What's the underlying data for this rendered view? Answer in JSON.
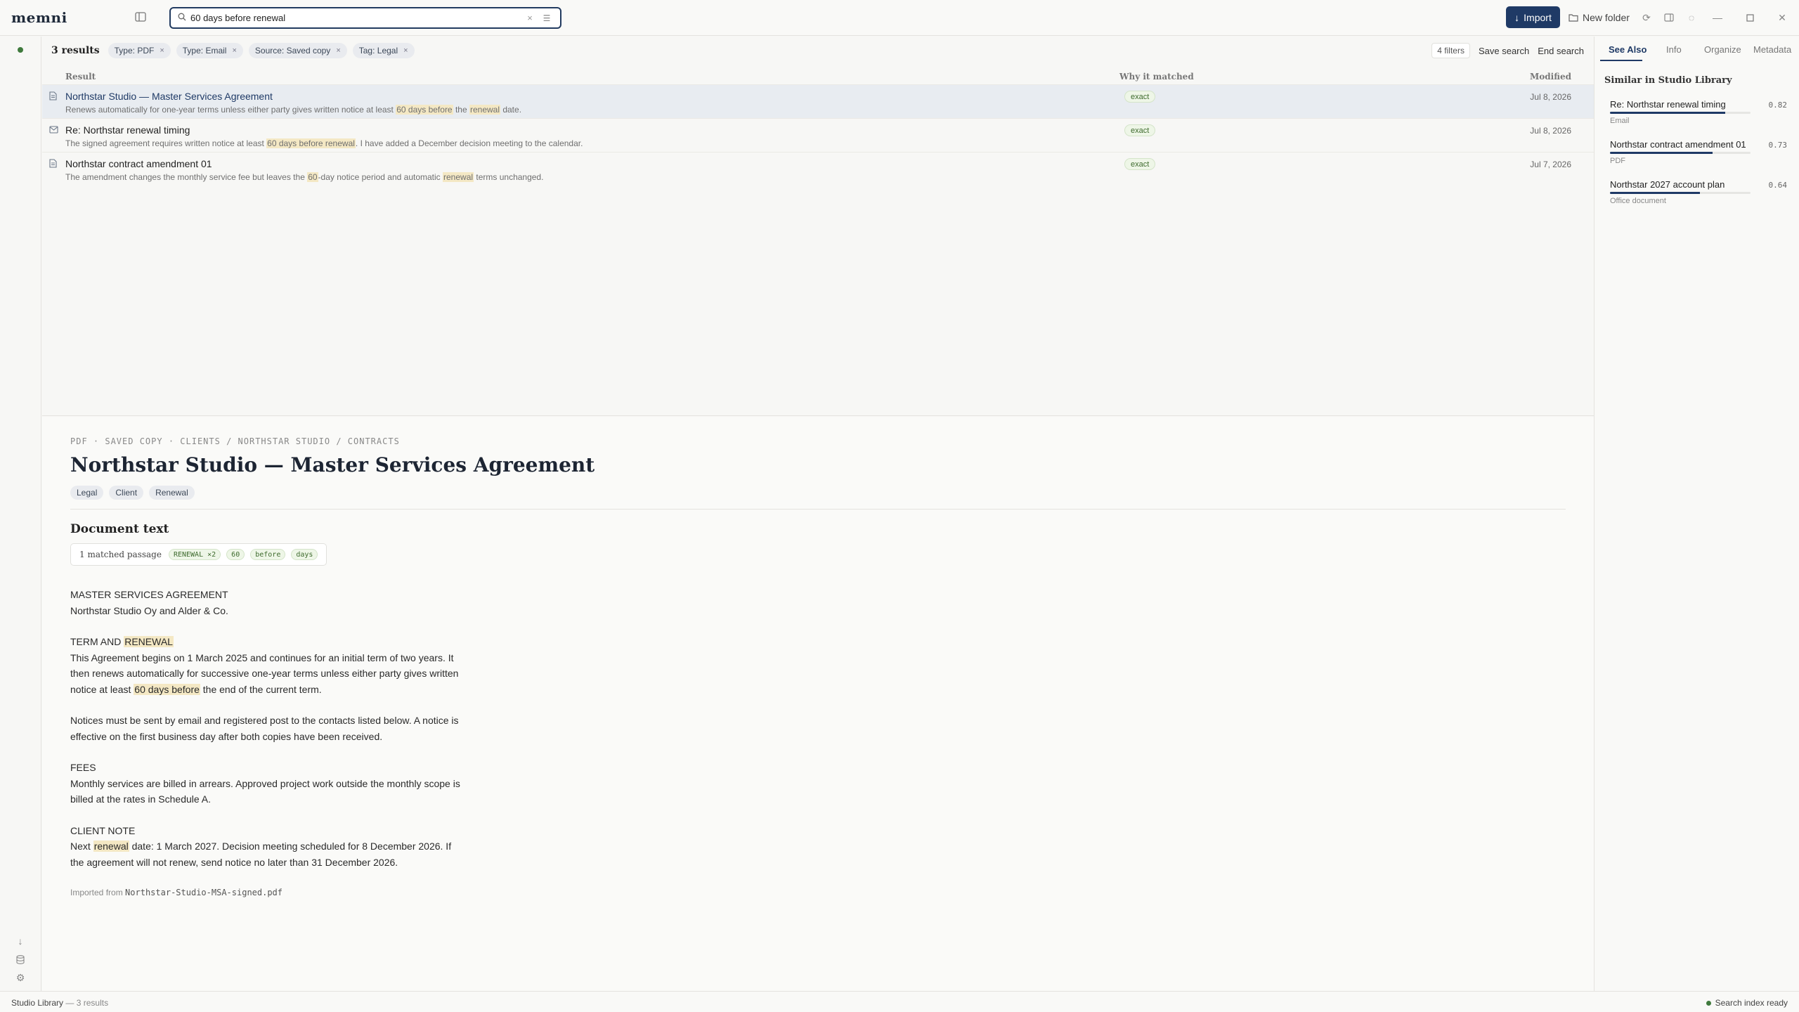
{
  "app": {
    "logo": "memni"
  },
  "search": {
    "value": "60 days before renewal"
  },
  "toolbar": {
    "import_label": "Import",
    "new_folder_label": "New folder"
  },
  "filters": {
    "result_count": "3 results",
    "chips": [
      "Type: PDF",
      "Type: Email",
      "Source: Saved copy",
      "Tag: Legal"
    ],
    "filter_count": "4 filters",
    "save_search": "Save search",
    "end_search": "End search"
  },
  "table": {
    "columns": {
      "result": "Result",
      "why": "Why it matched",
      "modified": "Modified"
    },
    "rows": [
      {
        "icon": "document-icon",
        "title": "Northstar Studio — Master Services Agreement",
        "snippet_html": "Renews automatically for one-year terms unless either party gives written notice at least <mark>60 days before</mark> the <mark>renewal</mark> date.",
        "why": "exact",
        "modified": "Jul 8, 2026"
      },
      {
        "icon": "mail-icon",
        "title": "Re: Northstar renewal timing",
        "snippet_html": "The signed agreement requires written notice at least <mark>60 days before renewal</mark>. I have added a December decision meeting to the calendar.",
        "why": "exact",
        "modified": "Jul 8, 2026"
      },
      {
        "icon": "document-icon",
        "title": "Northstar contract amendment 01",
        "snippet_html": "The amendment changes the monthly service fee but leaves the <mark>60</mark>-day notice period and automatic <mark>renewal</mark> terms unchanged.",
        "why": "exact",
        "modified": "Jul 7, 2026"
      }
    ]
  },
  "preview": {
    "breadcrumb": "PDF · SAVED COPY · CLIENTS / NORTHSTAR STUDIO / CONTRACTS",
    "title": "Northstar Studio — Master Services Agreement",
    "tags": [
      "Legal",
      "Client",
      "Renewal"
    ],
    "section_heading": "Document text",
    "matched_label": "1 matched passage",
    "matched_terms": [
      "RENEWAL ×2",
      "60",
      "before",
      "days"
    ],
    "paragraphs_html": [
      "MASTER SERVICES AGREEMENT<br>Northstar Studio Oy and Alder &amp; Co.",
      "TERM AND <mark>RENEWAL</mark><br>This Agreement begins on 1 March 2025 and continues for an initial term of two years. It then renews automatically for successive one-year terms unless either party gives written notice at least <mark>60 days before</mark> the end of the current term.",
      "Notices must be sent by email and registered post to the contacts listed below. A notice is effective on the first business day after both copies have been received.",
      "FEES<br>Monthly services are billed in arrears. Approved project work outside the monthly scope is billed at the rates in Schedule A.",
      "CLIENT NOTE<br>Next <mark>renewal</mark> date: 1 March 2027. Decision meeting scheduled for 8 December 2026. If the agreement will not renew, send notice no later than 31 December 2026."
    ],
    "imported_label": "Imported from",
    "imported_file": "Northstar-Studio-MSA-signed.pdf"
  },
  "right_panel": {
    "tabs": [
      "See Also",
      "Info",
      "Organize",
      "Metadata"
    ],
    "similar_heading": "Similar in Studio Library",
    "similar": [
      {
        "title": "Re: Northstar renewal timing",
        "score": "0.82",
        "score_value": 0.82,
        "type": "Email"
      },
      {
        "title": "Northstar contract amendment 01",
        "score": "0.73",
        "score_value": 0.73,
        "type": "PDF"
      },
      {
        "title": "Northstar 2027 account plan",
        "score": "0.64",
        "score_value": 0.64,
        "type": "Office document"
      }
    ]
  },
  "status": {
    "library": "Studio Library",
    "results": "— 3 results",
    "index": "Search index ready"
  },
  "colors": {
    "accent": "#1f3a66",
    "highlight": "#f4e8c4",
    "match_green": "#3e6b2e",
    "status_dot": "#3f7a3d"
  }
}
